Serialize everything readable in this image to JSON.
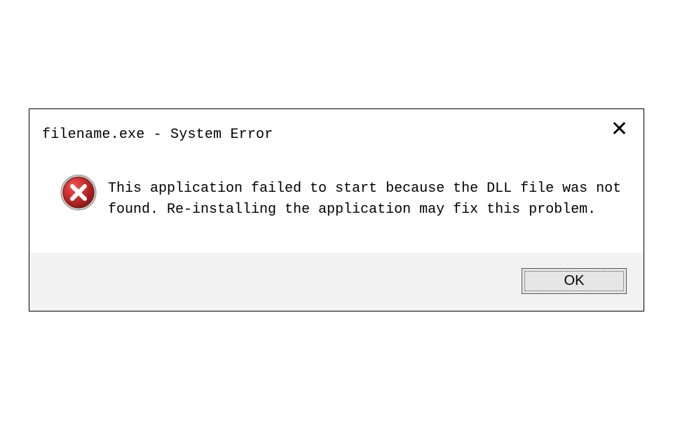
{
  "dialog": {
    "title": "filename.exe - System Error",
    "message": "This application failed to start because the DLL file was not found. Re-installing the application may fix this problem.",
    "ok_label": "OK"
  },
  "colors": {
    "icon_fill": "#c62828",
    "icon_border": "#8c1c1c",
    "icon_highlight": "#ef5350"
  }
}
